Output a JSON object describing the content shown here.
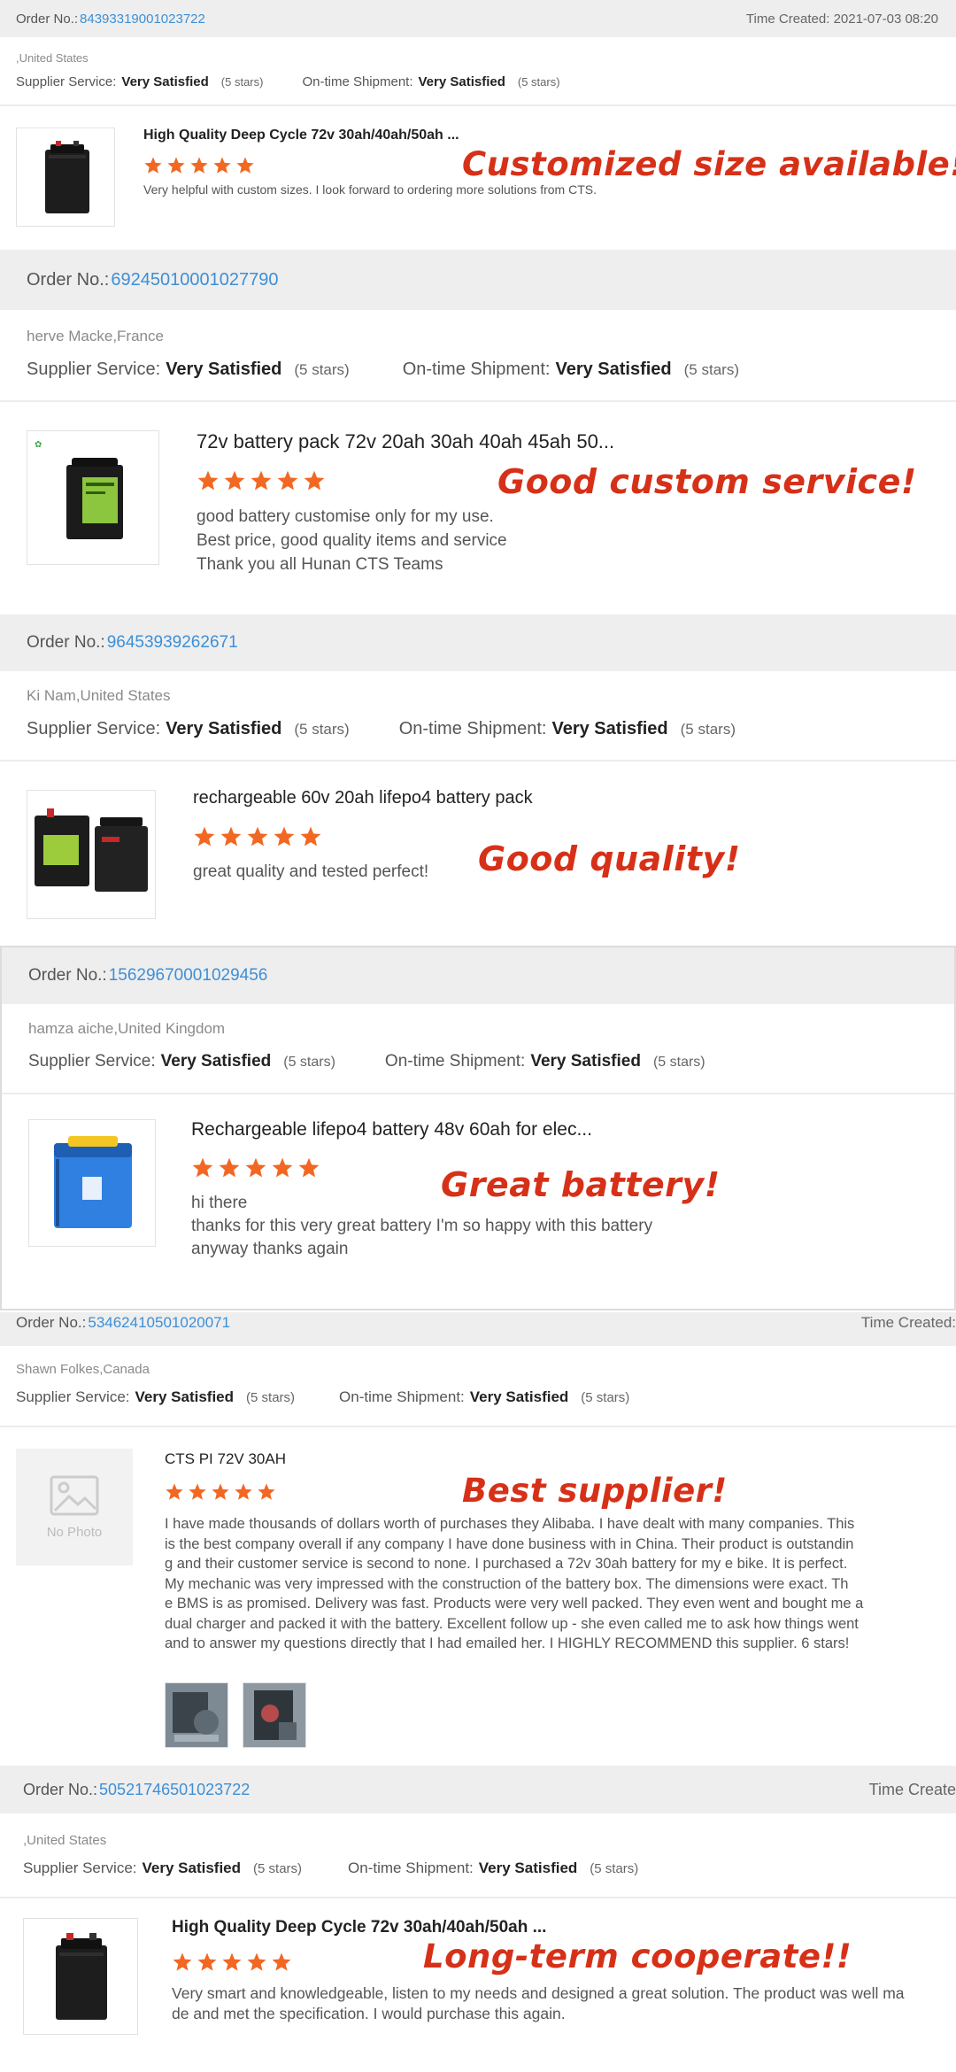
{
  "labels": {
    "order_no": "Order No.:",
    "time_created": "Time Created:",
    "supplier_service": "Supplier Service:",
    "ontime_shipment": "On-time Shipment:",
    "stars_5": "(5 stars)",
    "no_photo": "No Photo"
  },
  "colors": {
    "link_blue": "#3d8fd6",
    "star_orange": "#f26722",
    "overlay_red": "#d63118",
    "header_bg": "#eeeeee"
  },
  "reviews": [
    {
      "order_no": "84393319001023722",
      "time_created": "Time Created: 2021-07-03 08:20",
      "buyer": ",United States",
      "supplier_rating": "Very Satisfied",
      "shipment_rating": "Very Satisfied",
      "product_title": "High Quality Deep Cycle 72v 30ah/40ah/50ah ...",
      "stars": 5,
      "comment_lines": [
        "Very helpful with custom sizes. I look forward to ordering more solutions from CTS."
      ],
      "overlay": "Customized size available!",
      "image_icon": "black-battery-box-image"
    },
    {
      "order_no": "69245010001027790",
      "buyer": "herve Macke,France",
      "supplier_rating": "Very Satisfied",
      "shipment_rating": "Very Satisfied",
      "product_title": "72v battery pack 72v 20ah 30ah 40ah 45ah 50...",
      "stars": 5,
      "comment_lines": [
        "good battery customise only for my use.",
        "Best price, good quality items and service",
        "Thank you all Hunan CTS Teams"
      ],
      "overlay": "Good custom service!",
      "image_icon": "black-battery-box-green-label-image"
    },
    {
      "order_no": "96453939262671",
      "buyer": "Ki Nam,United States",
      "supplier_rating": "Very Satisfied",
      "shipment_rating": "Very Satisfied",
      "product_title": "rechargeable 60v 20ah lifepo4 battery pack",
      "stars": 5,
      "comment_lines": [
        "great quality and tested perfect!"
      ],
      "overlay": "Good quality!",
      "image_icon": "two-black-battery-boxes-image"
    },
    {
      "order_no": "15629670001029456",
      "buyer": "hamza aiche,United Kingdom",
      "supplier_rating": "Very Satisfied",
      "shipment_rating": "Very Satisfied",
      "product_title": "Rechargeable lifepo4 battery 48v 60ah for elec...",
      "stars": 5,
      "comment_lines": [
        "hi there",
        "thanks for this very great battery I'm so happy with this battery",
        "anyway thanks again"
      ],
      "overlay": "Great battery!",
      "image_icon": "blue-battery-pack-image"
    },
    {
      "order_no": "53462410501020071",
      "time_created": "Time Created:",
      "buyer": "Shawn Folkes,Canada",
      "supplier_rating": "Very Satisfied",
      "shipment_rating": "Very Satisfied",
      "product_title": "CTS PI 72V 30AH",
      "stars": 5,
      "comment_lines": [
        "I have made thousands of dollars worth of purchases they Alibaba. I have dealt with many companies. This",
        "is the best company overall if any company I have done business with in China. Their product is outstandin",
        "g and their customer service is second to none. I purchased a 72v 30ah battery for my e bike. It is perfect.",
        "My mechanic was very impressed with the construction of the battery box. The dimensions were exact. Th",
        "e BMS is as promised. Delivery was fast. Products were very well packed. They even went and bought me a",
        "dual charger and packed it with the battery. Excellent follow up - she even called me to ask how things went",
        "and to answer my questions directly that I had emailed her. I HIGHLY RECOMMEND this supplier. 6 stars!"
      ],
      "overlay": "Best supplier!",
      "image_icon": "no-photo-placeholder-icon"
    },
    {
      "order_no": "50521746501023722",
      "time_created": "Time Create",
      "buyer": ",United States",
      "supplier_rating": "Very Satisfied",
      "shipment_rating": "Very Satisfied",
      "product_title": "High Quality Deep Cycle 72v 30ah/40ah/50ah ...",
      "stars": 5,
      "comment_lines": [
        "Very smart and knowledgeable, listen to my needs and designed a great solution. The product was well ma",
        "de and met the specification. I would purchase this again."
      ],
      "overlay": "Long-term cooperate!!",
      "image_icon": "black-battery-box-image"
    }
  ]
}
